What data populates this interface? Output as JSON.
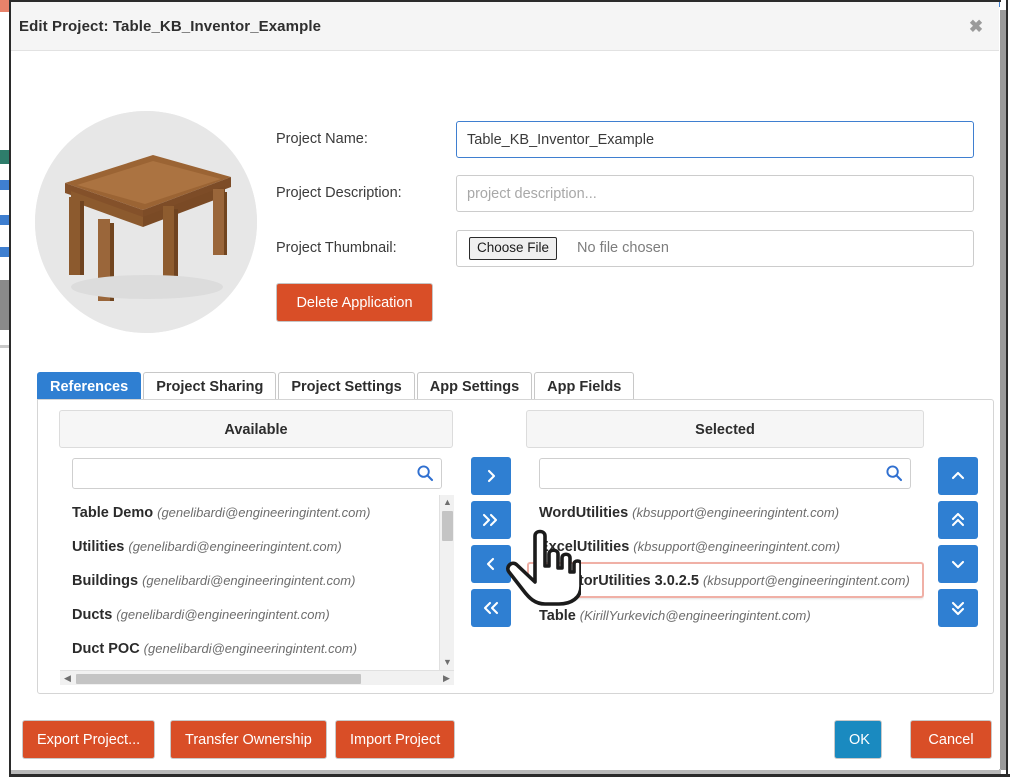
{
  "window": {
    "title": "Edit Project: Table_KB_Inventor_Example",
    "close_label": "✖"
  },
  "form": {
    "name_label": "Project Name:",
    "name_value": "Table_KB_Inventor_Example",
    "description_label": "Project Description:",
    "description_value": "",
    "description_placeholder": "project description...",
    "thumbnail_label": "Project Thumbnail:",
    "choose_file_label": "Choose File",
    "file_status": "No file chosen",
    "delete_label": "Delete Application"
  },
  "tabs": [
    {
      "label": "References",
      "active": true
    },
    {
      "label": "Project Sharing",
      "active": false
    },
    {
      "label": "Project Settings",
      "active": false
    },
    {
      "label": "App Settings",
      "active": false
    },
    {
      "label": "App Fields",
      "active": false
    }
  ],
  "references": {
    "available": {
      "header": "Available",
      "search_value": "",
      "search_placeholder": "",
      "search_icon": "search-icon",
      "items": [
        {
          "name": "Table Demo",
          "owner": "(genelibardi@engineeringintent.com)"
        },
        {
          "name": "Utilities",
          "owner": "(genelibardi@engineeringintent.com)"
        },
        {
          "name": "Buildings",
          "owner": "(genelibardi@engineeringintent.com)"
        },
        {
          "name": "Ducts",
          "owner": "(genelibardi@engineeringintent.com)"
        },
        {
          "name": "Duct POC",
          "owner": "(genelibardi@engineeringintent.com)"
        }
      ]
    },
    "selected": {
      "header": "Selected",
      "search_value": "",
      "search_placeholder": "",
      "search_icon": "search-icon",
      "items": [
        {
          "name": "WordUtilities",
          "owner": "(kbsupport@engineeringintent.com)",
          "highlighted": false
        },
        {
          "name": "ExcelUtilities",
          "owner": "(kbsupport@engineeringintent.com)",
          "highlighted": false
        },
        {
          "name": "InventorUtilities 3.0.2.5",
          "owner": "(kbsupport@engineeringintent.com)",
          "highlighted": true
        },
        {
          "name": "Table",
          "owner": "(KirillYurkevich@engineeringintent.com)",
          "highlighted": false
        }
      ]
    },
    "transfer_buttons": [
      {
        "icon": "chevron-right-icon",
        "name": "move-right-button"
      },
      {
        "icon": "chevron-double-right-icon",
        "name": "move-all-right-button"
      },
      {
        "icon": "chevron-left-icon",
        "name": "move-left-button"
      },
      {
        "icon": "chevron-double-left-icon",
        "name": "move-all-left-button"
      }
    ],
    "reorder_buttons": [
      {
        "icon": "chevron-up-icon",
        "name": "move-up-button"
      },
      {
        "icon": "chevron-double-up-icon",
        "name": "move-top-button"
      },
      {
        "icon": "chevron-down-icon",
        "name": "move-down-button"
      },
      {
        "icon": "chevron-double-down-icon",
        "name": "move-bottom-button"
      }
    ]
  },
  "footer": {
    "export_label": "Export Project...",
    "transfer_label": "Transfer Ownership",
    "import_label": "Import Project",
    "ok_label": "OK",
    "cancel_label": "Cancel"
  },
  "colors": {
    "accent_blue": "#2f7fd2",
    "danger_red": "#d94e27",
    "ok_blue": "#1a8ac0",
    "highlight_border": "#f0b0a6",
    "header_bg": "#f5f5f5"
  }
}
